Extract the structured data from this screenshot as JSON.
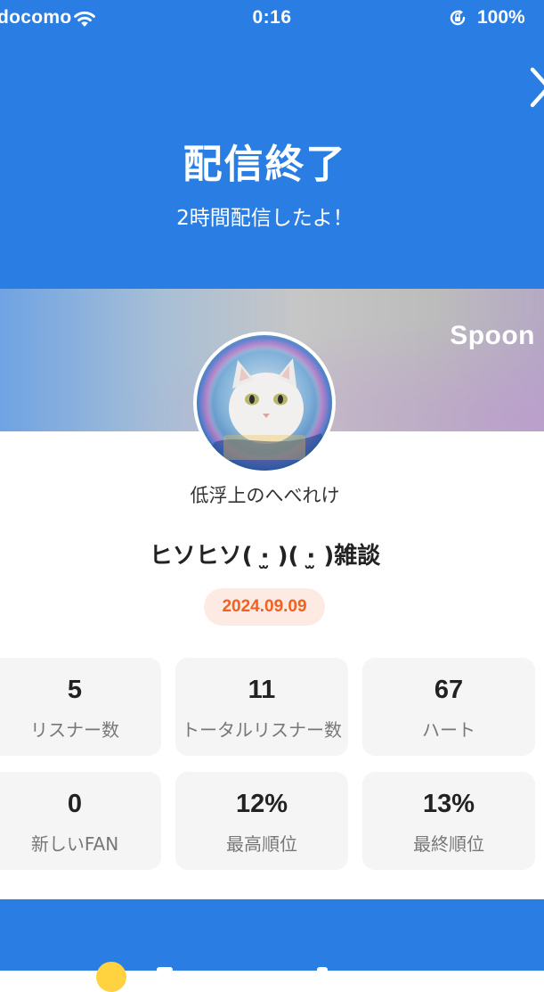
{
  "status_bar": {
    "carrier": "docomo",
    "time": "0:16",
    "battery": "100%"
  },
  "header": {
    "title": "配信終了",
    "subtitle": "2時間配信したよ！"
  },
  "banner": {
    "brand": "Spoon"
  },
  "profile": {
    "host_name": "低浮上のへべれけ",
    "broadcast_title": "ヒソヒソ( ·̫ )( ·̫ )雑談",
    "date": "2024.09.09"
  },
  "stats": [
    {
      "value": "5",
      "label": "リスナー数"
    },
    {
      "value": "11",
      "label": "トータルリスナー数"
    },
    {
      "value": "67",
      "label": "ハート"
    },
    {
      "value": "0",
      "label": "新しいFAN"
    },
    {
      "value": "12%",
      "label": "最高順位"
    },
    {
      "value": "13%",
      "label": "最終順位"
    }
  ],
  "colors": {
    "primary_blue": "#2a7ee3",
    "date_text": "#f2611f",
    "date_bg": "#fdebe3",
    "card_bg": "#f5f5f5"
  },
  "icons": [
    "wifi-icon",
    "rotation-lock-icon",
    "close-icon",
    "avatar-image"
  ]
}
